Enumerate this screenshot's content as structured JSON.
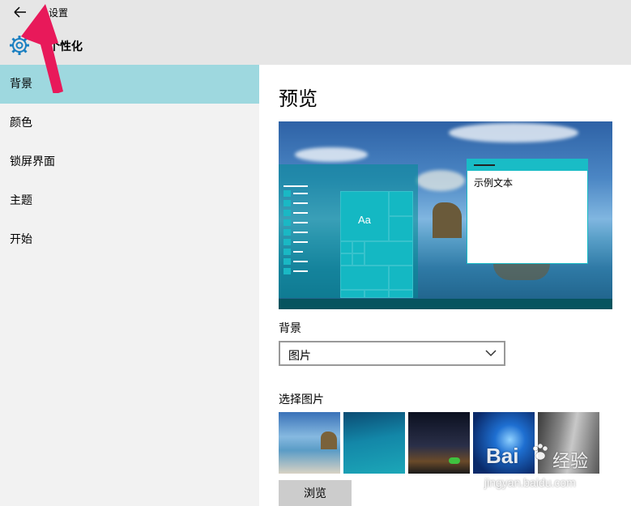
{
  "titlebar": {
    "title": "设置"
  },
  "header": {
    "title": "个性化"
  },
  "sidebar": {
    "items": [
      {
        "label": "背景",
        "active": true
      },
      {
        "label": "颜色",
        "active": false
      },
      {
        "label": "锁屏界面",
        "active": false
      },
      {
        "label": "主题",
        "active": false
      },
      {
        "label": "开始",
        "active": false
      }
    ]
  },
  "main": {
    "preview_title": "预览",
    "preview": {
      "tile_text": "Aa",
      "sample_text": "示例文本"
    },
    "background_label": "背景",
    "background_select": {
      "value": "图片"
    },
    "choose_picture_label": "选择图片",
    "thumbnails": [
      "beach-rock",
      "underwater",
      "night-sky",
      "windows-blue",
      "rock-cliff"
    ],
    "browse_label": "浏览"
  },
  "watermark": {
    "brand": "Bai",
    "brand_suffix": "经验",
    "url": "jingyan.baidu.com"
  },
  "colors": {
    "accent": "#9ed8df",
    "tile": "#14b8c3",
    "sidebar_bg": "#f2f2f2",
    "titlebar_bg": "#e6e6e6",
    "annotation_arrow": "#e8195a"
  }
}
